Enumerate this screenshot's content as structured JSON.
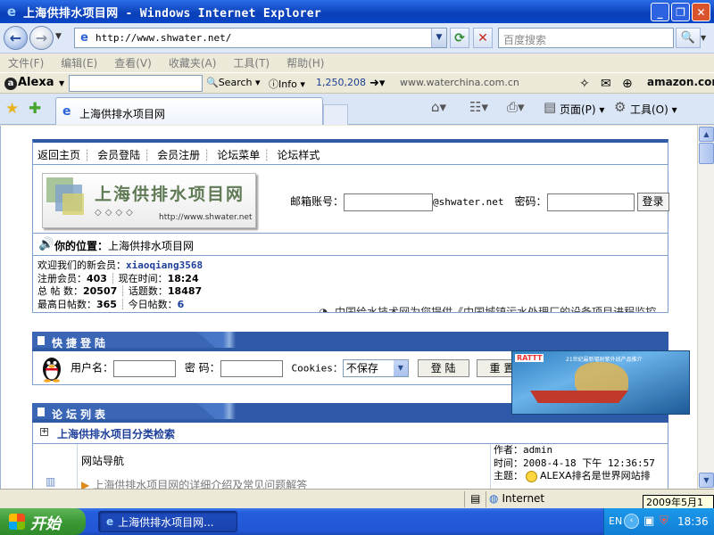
{
  "window": {
    "title": "上海供排水项目网 - Windows Internet Explorer"
  },
  "address": {
    "url": "http://www.shwater.net/",
    "search_placeholder": "百度搜索"
  },
  "menu": [
    "文件(F)",
    "编辑(E)",
    "查看(V)",
    "收藏夹(A)",
    "工具(T)",
    "帮助(H)"
  ],
  "alexa": {
    "logo": "Alexa",
    "search_label": "Search",
    "info_label": "Info",
    "rank": "1,250,208",
    "site": "www.waterchina.com.cn",
    "amazon": "amazon.com"
  },
  "tabs": {
    "active_label": "上海供排水项目网",
    "page_label": "页面(P)",
    "tools_label": "工具(O)"
  },
  "site": {
    "nav": [
      "返回主页",
      "会员登陆",
      "会员注册",
      "论坛菜单",
      "论坛样式"
    ],
    "logo_title": "上海供排水项目网",
    "logo_diamonds": "◇◇◇◇",
    "logo_url": "http://www.shwater.net",
    "login": {
      "email_label": "邮箱账号：",
      "domain": "@shwater.net",
      "password_label": "密码：",
      "button": "登录"
    },
    "location_label": "你的位置：",
    "location_value": "上海供排水项目网",
    "stats": {
      "welcome_label": "欢迎我们的新会员：",
      "new_member": "xiaoqiang3568",
      "members_label": "注册会员：",
      "members": "403",
      "time_label": "现在时间：",
      "time": "18:24",
      "posts_label": "总 帖 数：",
      "posts": "20507",
      "topics_label": "话题数：",
      "topics": "18487",
      "max_label": "最高日帖数：",
      "max": "365",
      "today_label": "今日帖数：",
      "today": "6",
      "marquee": "中国给水技术网为您提供《中国城镇污水处理厂的设备项目进程监控"
    },
    "quick_login": {
      "title": "快捷登陆",
      "user_label": "用户名：",
      "pass_label": "密 码：",
      "cookies_label": "Cookies：",
      "cookies_value": "不保存",
      "login_btn": "登 陆",
      "reset_btn": "重 置"
    },
    "forum_list": {
      "title": "论坛列表",
      "category": "上海供排水项目分类检索",
      "board_name": "网站导航",
      "board_desc": "上海供排水项目网的详细介绍及常见问题解答",
      "author_label": "作者：",
      "author": "admin",
      "time_label": "时间：",
      "time": "2008-4-18 下午 12:36:57",
      "topic_label": "主题：",
      "topic": "ALEXA排名是世界网站排"
    },
    "ad_brand": "RATTT",
    "ad_text": "21世纪最新辐射紫外线产品推介"
  },
  "status": {
    "zone": "Internet",
    "date_tip": "2009年5月1日"
  },
  "taskbar": {
    "start": "开始",
    "item": "上海供排水项目网...",
    "lang": "EN",
    "clock": "18:36"
  }
}
